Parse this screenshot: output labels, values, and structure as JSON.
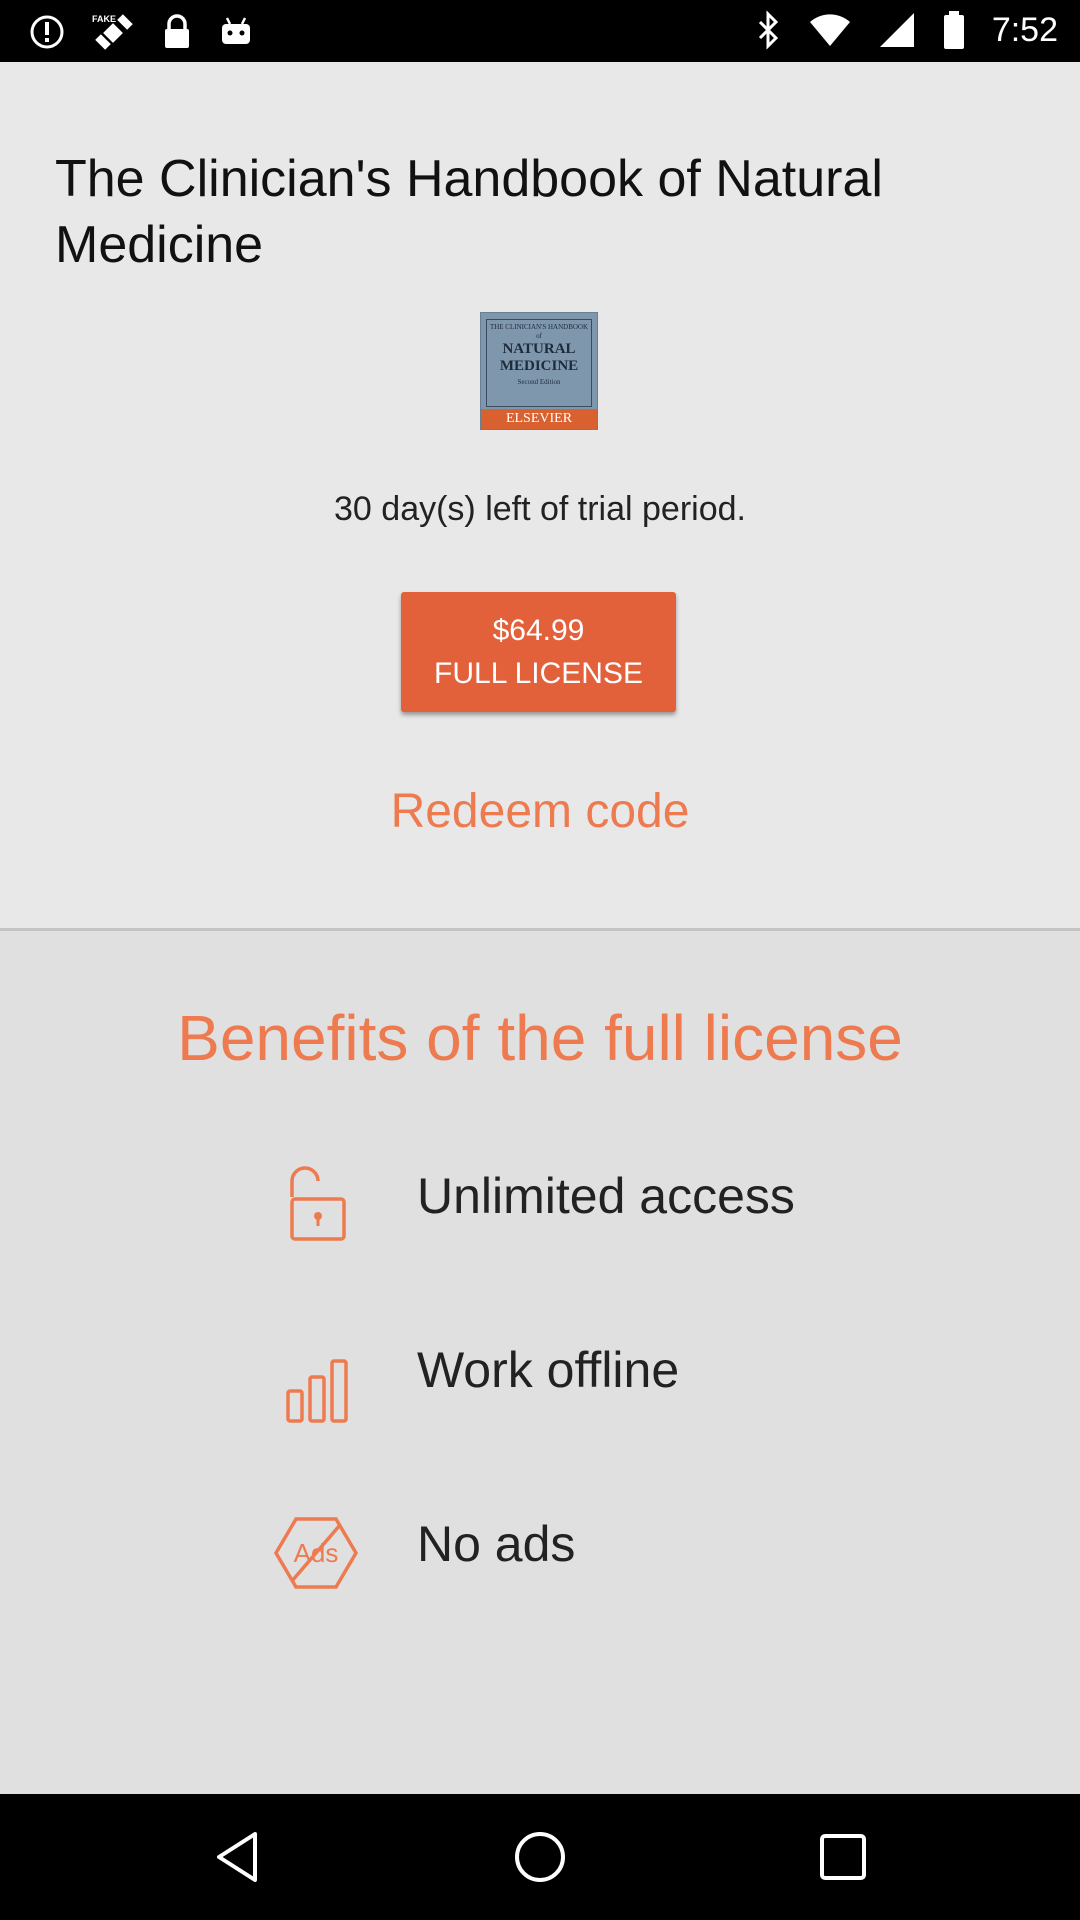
{
  "status_bar": {
    "time": "7:52",
    "left_icons": [
      "alert-icon",
      "fake-gps-icon",
      "lock-icon",
      "android-icon"
    ],
    "right_icons": [
      "bluetooth-icon",
      "wifi-icon",
      "signal-icon",
      "battery-icon"
    ]
  },
  "book": {
    "title": "The Clinician's Handbook of Natural Medicine",
    "cover": {
      "small_text": "THE CLINICIAN'S HANDBOOK of",
      "big_text_1": "NATURAL",
      "big_text_2": "MEDICINE",
      "edition": "Second Edition",
      "publisher": "ELSEVIER"
    }
  },
  "trial": {
    "message": "30 day(s) left of trial period."
  },
  "purchase": {
    "price": "$64.99",
    "label": "FULL LICENSE"
  },
  "redeem": {
    "label": "Redeem code"
  },
  "benefits": {
    "title": "Benefits of the full license",
    "items": [
      {
        "label": "Unlimited access",
        "icon": "unlock-icon"
      },
      {
        "label": "Work offline",
        "icon": "bar-chart-icon"
      },
      {
        "label": "No ads",
        "icon": "no-ads-icon",
        "icon_text": "Ads"
      }
    ]
  },
  "colors": {
    "accent": "#ee7a50",
    "button": "#e2603a",
    "background": "#e6e6e6"
  },
  "nav_bar": {
    "buttons": [
      "back-icon",
      "home-icon",
      "recents-icon"
    ]
  }
}
